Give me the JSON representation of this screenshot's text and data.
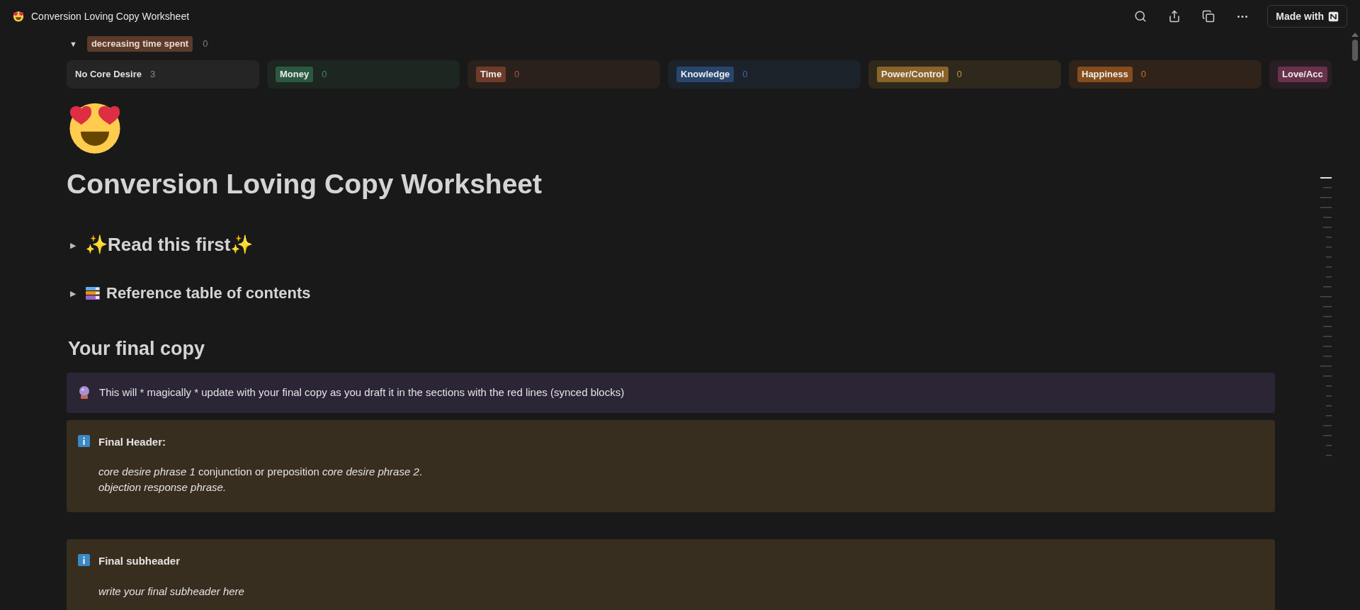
{
  "window": {
    "title": "Conversion Loving Copy Worksheet",
    "made_with": "Made with"
  },
  "group": {
    "caret": "▼",
    "label": "decreasing time spent",
    "count": "0",
    "expanded": true
  },
  "board_columns": [
    {
      "kind": "plain",
      "label": "No Core Desire",
      "count": "3"
    },
    {
      "kind": "chip",
      "label": "Money",
      "count": "0",
      "color": "#2b593f"
    },
    {
      "kind": "chip",
      "label": "Time",
      "count": "0",
      "color": "#6e3b2a"
    },
    {
      "kind": "chip",
      "label": "Knowledge",
      "count": "0",
      "color": "#28456c"
    },
    {
      "kind": "chip",
      "label": "Power/Control",
      "count": "0",
      "color": "#89632a"
    },
    {
      "kind": "chip",
      "label": "Happiness",
      "count": "0",
      "color": "#854c1d"
    },
    {
      "kind": "chip",
      "label": "Love/Acc",
      "color": "#69314c"
    }
  ],
  "page": {
    "title": "Conversion Loving Copy Worksheet",
    "toggles": [
      {
        "kind": "sparkle",
        "icon": "▶",
        "text": "✨Read this first✨",
        "expanded": false
      },
      {
        "kind": "books",
        "icon": "▶",
        "text": "Reference table of contents",
        "expanded": false
      }
    ],
    "section_heading": "Your final copy",
    "callouts": [
      {
        "kind": "crystal",
        "title": "This will * magically * update with your final copy as you draft it in the sections with the red lines (synced blocks)"
      },
      {
        "kind": "info",
        "title": "Final Header:",
        "lines": [
          "*core desire phrase 1* conjunction or preposition *core desire phrase 2*.",
          "*objection response phrase.*"
        ]
      },
      {
        "kind": "info",
        "title": "Final subheader",
        "lines": [
          "*write your final subheader here*"
        ]
      }
    ]
  }
}
